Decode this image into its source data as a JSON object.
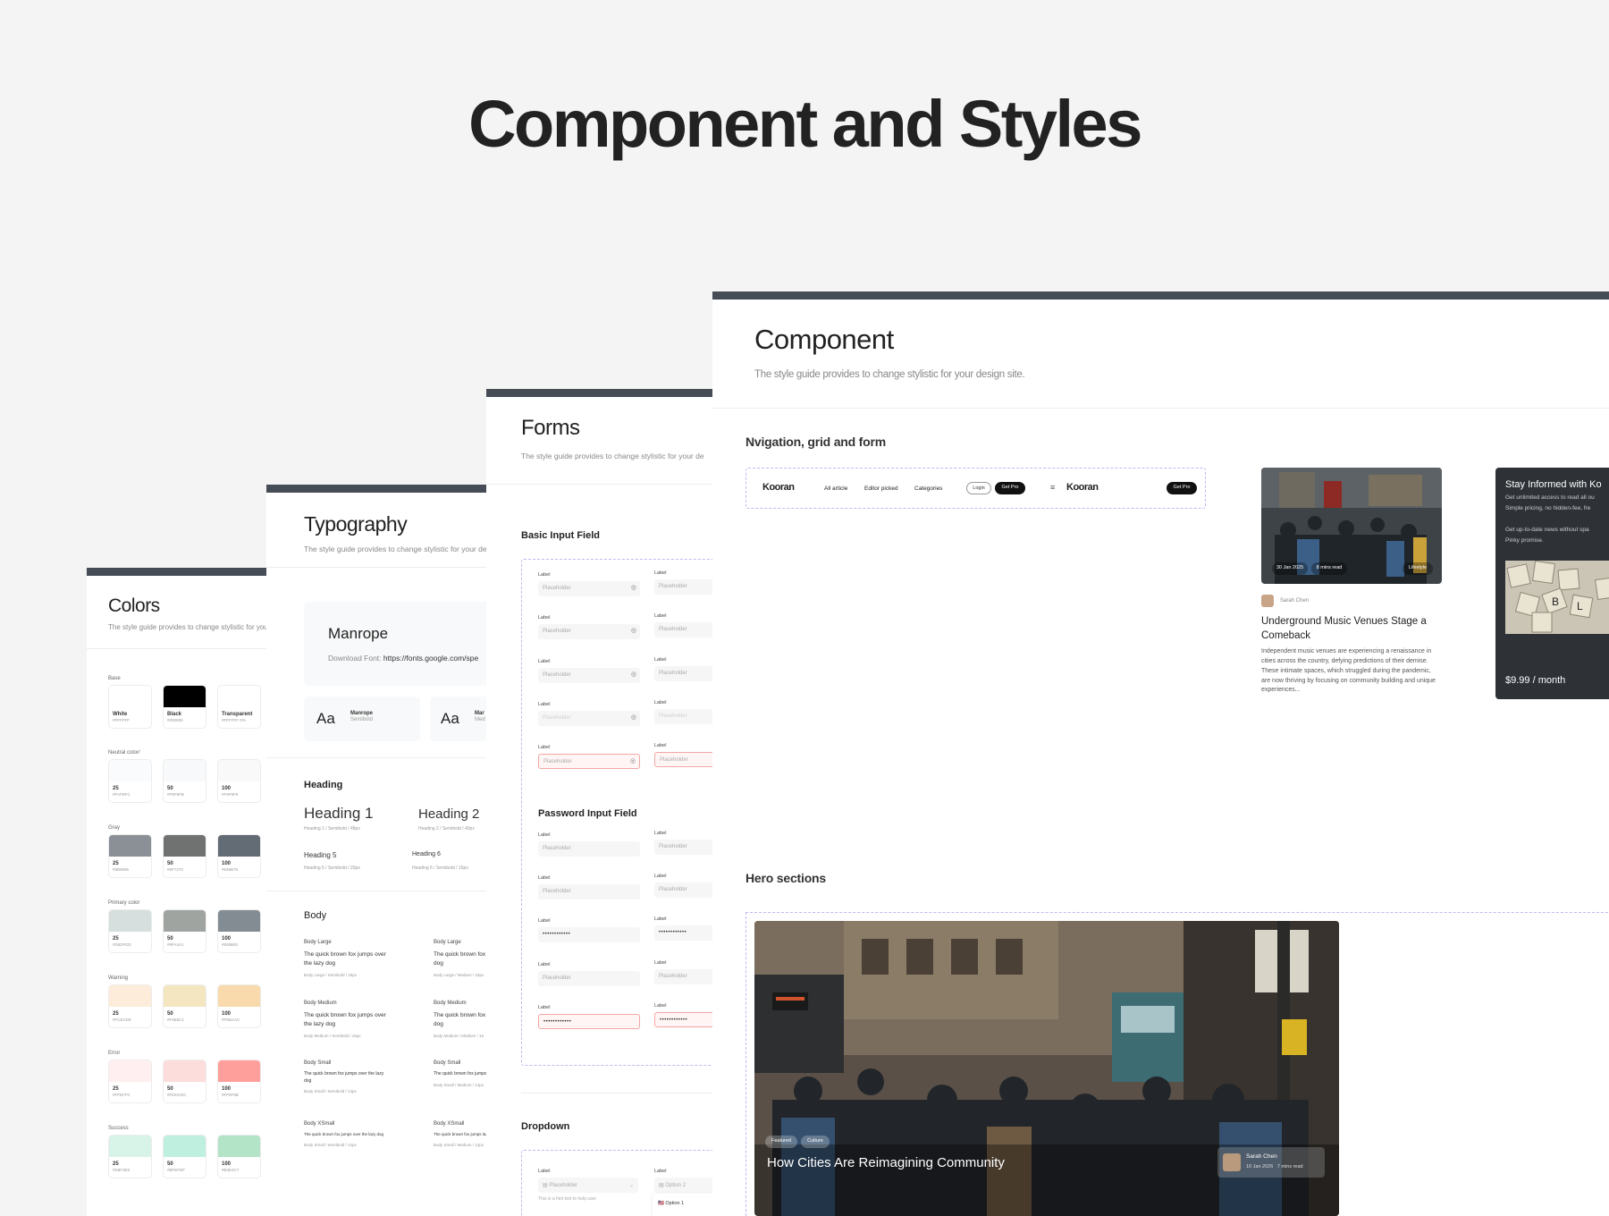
{
  "page": {
    "title": "Component and Styles"
  },
  "colors": {
    "title": "Colors",
    "subtitle": "The style guide provides to change stylistic for your des",
    "groups": [
      {
        "label": "Base",
        "swatches": [
          {
            "name": "White",
            "hex": "#FFFFFF"
          },
          {
            "name": "Black",
            "hex": "#000000"
          },
          {
            "name": "Transparent",
            "hex": "#FFFFFF 0%"
          }
        ]
      },
      {
        "label": "Neutral color/",
        "swatches": [
          {
            "name": "25",
            "hex": "#FAFBFC"
          },
          {
            "name": "50",
            "hex": "#F8F9FB"
          },
          {
            "name": "100",
            "hex": "#F9F9F9"
          }
        ]
      },
      {
        "label": "Gray",
        "swatches": [
          {
            "name": "25",
            "hex": "#8B9096"
          },
          {
            "name": "50",
            "hex": "#6F7270"
          },
          {
            "name": "100",
            "hex": "#636B75"
          }
        ]
      },
      {
        "label": "Primary color",
        "swatches": [
          {
            "name": "25",
            "hex": "#D6DFDD"
          },
          {
            "name": "50",
            "hex": "#9FA4A1"
          },
          {
            "name": "100",
            "hex": "#838B93"
          }
        ]
      },
      {
        "label": "Warning",
        "swatches": [
          {
            "name": "25",
            "hex": "#FCECD9"
          },
          {
            "name": "50",
            "hex": "#F4E6C1"
          },
          {
            "name": "100",
            "hex": "#F8DAAC"
          }
        ]
      },
      {
        "label": "Error",
        "swatches": [
          {
            "name": "25",
            "hex": "#FFEFF0"
          },
          {
            "name": "50",
            "hex": "#FDDCDC"
          },
          {
            "name": "100",
            "hex": "#FF9F9B"
          }
        ]
      },
      {
        "label": "Success",
        "swatches": [
          {
            "name": "25",
            "hex": "#D8F3E8"
          },
          {
            "name": "50",
            "hex": "#BFEFDF"
          },
          {
            "name": "100",
            "hex": "#B3E4C7"
          }
        ]
      }
    ]
  },
  "typography": {
    "title": "Typography",
    "subtitle": "The style guide provides to change stylistic for your desig",
    "font_name": "Manrope",
    "download_label": "Download Font:",
    "download_url": "https://fonts.google.com/spe",
    "aa": "Aa",
    "sample1_name": "Manrope",
    "sample1_weight": "Semibold",
    "sample2_name": "Mar",
    "sample2_weight": "Med",
    "heading_section": "Heading",
    "h1": "Heading 1",
    "h1_meta": "Heading 1 / Semibold / 48px",
    "h2": "Heading 2",
    "h2_meta": "Heading 2 / Semibold / 40px",
    "h5": "Heading 5",
    "h5_meta": "Heading 5 / Semibold / 20px",
    "h6": "Heading 6",
    "h6_meta": "Heading 6 / Semibold / 16px",
    "body_section": "Body",
    "bodies": [
      {
        "left_title": "Body Large",
        "left_text": "The quick brown fox jumps over the lazy dog",
        "left_meta": "Body Large / Semibold / 18px",
        "right_title": "Body Large",
        "right_text": "The quick brown fox j the lazy dog",
        "right_meta": "Body Large / Medium / 18px"
      },
      {
        "left_title": "Body Medium",
        "left_text": "The quick brown fox jumps over the lazy dog",
        "left_meta": "Body Medium / Semibold / 16px",
        "right_title": "Body Medium",
        "right_text": "The quick brown fox jum the lazy dog",
        "right_meta": "Body Medium / Medium / 16"
      },
      {
        "left_title": "Body Small",
        "left_text": "The quick brown fox jumps over the lazy dog",
        "left_meta": "Body Small / Semibold / 14px",
        "right_title": "Body Small",
        "right_text": "The quick brown fox jumps the lazy dog",
        "right_meta": "Body Small / Medium / 14px"
      },
      {
        "left_title": "Body XSmall",
        "left_text": "The quick brown fox jumps over the lazy dog",
        "left_meta": "Body Small / Semibold / 12px",
        "right_title": "Body XSmall",
        "right_text": "The quick brown fox jumps lazy dog",
        "right_meta": "Body Small / Medium / 12px"
      }
    ]
  },
  "forms": {
    "title": "Forms",
    "subtitle": "The style guide provides to change stylistic for your de",
    "basic_section": "Basic Input Field",
    "password_section": "Password Input Field",
    "dropdown_section": "Dropdown",
    "label": "Label",
    "placeholder": "Placeholder",
    "password_mask": "••••••••••••",
    "dropdown_hint": "This is a hint text to help user",
    "option2": "Option 2",
    "option1": "Option 1"
  },
  "component": {
    "title": "Component",
    "subtitle": "The style guide provides to change stylistic for your design site.",
    "nav_section": "Nvigation, grid and form",
    "hero_section": "Hero sections",
    "nav": {
      "logo": "Kooran",
      "links": [
        "All article",
        "Editor picked",
        "Categories"
      ],
      "login": "Login",
      "getpro": "Get Pro",
      "getpro2": "Get Pro",
      "logo2": "Kooran"
    },
    "card": {
      "date": "30 Jan 2025",
      "read": "8 mins read",
      "tag": "Lifestyle",
      "author": "Sarah Chen",
      "title": "Underground Music Venues Stage a Comeback",
      "excerpt": "Independent music venues are experiencing a renaissance in cities across the country, defying predictions of their demise. These intimate spaces, which struggled during the pandemic, are now thriving by focusing on community building and unique experiences..."
    },
    "promo": {
      "title": "Stay Informed with Ko",
      "line1": "Get unlimited access to read all ou",
      "line2": "Simple pricing, no hidden-fee, fre",
      "line3": "Get up-to-date news without spa",
      "line4": "Pinky promise.",
      "price": "$9.99 / month"
    },
    "hero": {
      "tag1": "Featured",
      "tag2": "Culture",
      "title": "How Cities Are Reimagining Community",
      "author": "Sarah Chen",
      "date": "10 Jan 2026",
      "read": "7 mins read"
    }
  }
}
